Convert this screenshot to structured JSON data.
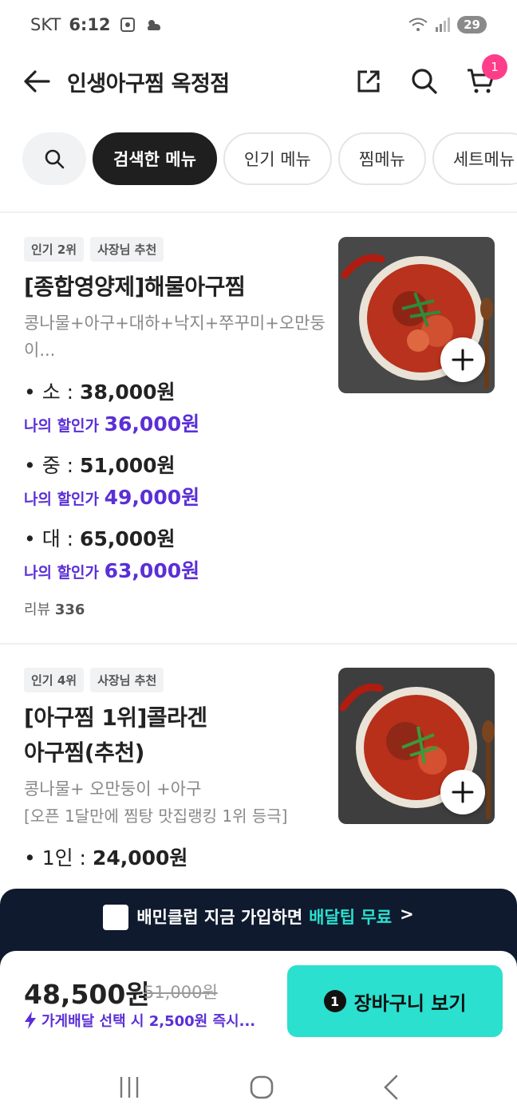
{
  "status": {
    "carrier": "SKT",
    "time": "6:12",
    "battery": "29"
  },
  "header": {
    "title": "인생아구찜 옥정점",
    "cart_count": "1"
  },
  "chips": [
    "검색한 메뉴",
    "인기 메뉴",
    "찜메뉴",
    "세트메뉴"
  ],
  "items": [
    {
      "tags": [
        "인기 2위",
        "사장님 추천"
      ],
      "name": "[종합영양제]해물아구찜",
      "desc": "콩나물+아구+대하+낙지+쭈꾸미+오만둥이...",
      "prices": [
        {
          "size": "소",
          "price": "38,000원",
          "disc_label": "나의 할인가",
          "disc": "36,000원"
        },
        {
          "size": "중",
          "price": "51,000원",
          "disc_label": "나의 할인가",
          "disc": "49,000원"
        },
        {
          "size": "대",
          "price": "65,000원",
          "disc_label": "나의 할인가",
          "disc": "63,000원"
        }
      ],
      "reviews_label": "리뷰",
      "reviews": "336"
    },
    {
      "tags": [
        "인기 4위",
        "사장님 추천"
      ],
      "name": "[아구찜 1위]콜라겐 아구찜(추천)",
      "desc": "콩나물+ 오만둥이 +아구",
      "desc2": "[오픈 1달만에 찜탕 맛집랭킹 1위 등극]",
      "prices": [
        {
          "size": "1인",
          "price": "24,000원"
        }
      ]
    }
  ],
  "club": {
    "text": "배민클럽 지금 가입하면",
    "highlight": "배달팁 무료",
    "arrow": ">"
  },
  "bottom": {
    "total": "48,500원",
    "original": "51,000원",
    "notice": "가게배달 선택 시 2,500원 즉시...",
    "cart_button": "장바구니 보기",
    "cart_count": "1"
  },
  "colors": {
    "accent": "#2be0cf",
    "discount": "#5b2fd6",
    "badge": "#ff3d8a",
    "banner": "#0f1a2e"
  }
}
